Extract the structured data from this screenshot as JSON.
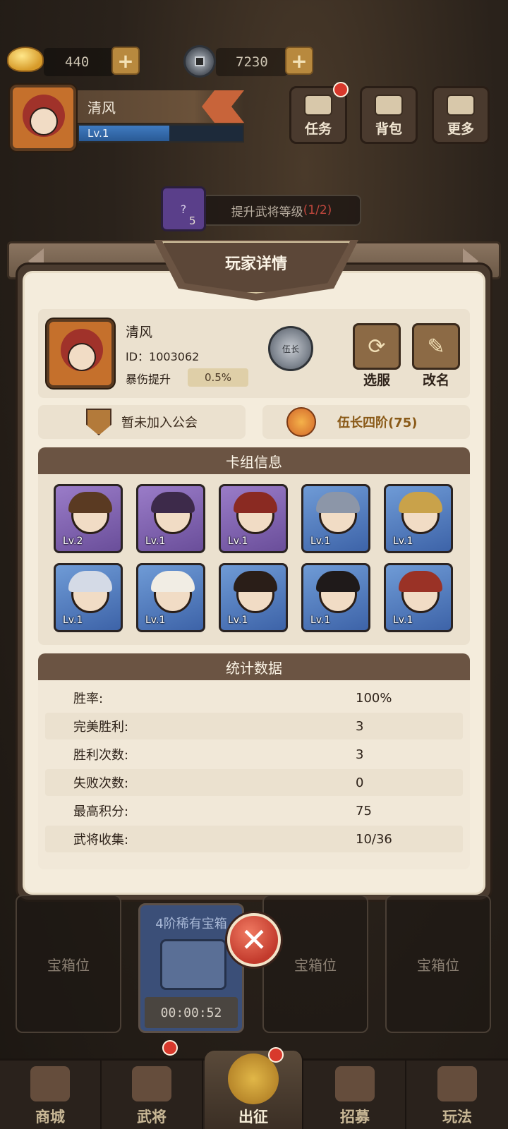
{
  "hud": {
    "gold_value": "440",
    "copper_value": "7230"
  },
  "player_card": {
    "name": "清风",
    "level": "Lv.1",
    "level_fill_pct": 55
  },
  "menu": {
    "task": "任务",
    "bag": "背包",
    "more": "更多"
  },
  "task_hint": {
    "card_count": "5",
    "card_icon_text": "?",
    "text": "提升武将等级",
    "progress": "(1/2)"
  },
  "dialog": {
    "title": "玩家详情",
    "player": {
      "name": "清风",
      "id": "ID：1003062",
      "crit_label": "暴伤提升",
      "crit_value": "0.5%",
      "rank_badge_text": "伍长",
      "switch_server_label": "选服",
      "rename_label": "改名"
    },
    "guild_text": "暂未加入公会",
    "rank_text": "伍长四阶(75)",
    "deck": {
      "title": "卡组信息",
      "heroes": [
        {
          "level": "Lv.2",
          "frame": "purple",
          "hair": "#5a3a22"
        },
        {
          "level": "Lv.1",
          "frame": "purple",
          "hair": "#3d2a4a"
        },
        {
          "level": "Lv.1",
          "frame": "purple",
          "hair": "#8a2a22"
        },
        {
          "level": "Lv.1",
          "frame": "blue",
          "hair": "#8c96a8"
        },
        {
          "level": "Lv.1",
          "frame": "blue",
          "hair": "#c9a24a"
        },
        {
          "level": "Lv.1",
          "frame": "blue",
          "hair": "#d4dae6"
        },
        {
          "level": "Lv.1",
          "frame": "blue",
          "hair": "#f1ede4"
        },
        {
          "level": "Lv.1",
          "frame": "blue",
          "hair": "#2a1e18"
        },
        {
          "level": "Lv.1",
          "frame": "blue",
          "hair": "#1f1a1a"
        },
        {
          "level": "Lv.1",
          "frame": "blue",
          "hair": "#9a3226"
        }
      ]
    },
    "stats": {
      "title": "统计数据",
      "rows": [
        {
          "label": "胜率:",
          "value": "100%"
        },
        {
          "label": "完美胜利:",
          "value": "3"
        },
        {
          "label": "胜利次数:",
          "value": "3"
        },
        {
          "label": "失败次数:",
          "value": "0"
        },
        {
          "label": "最高积分:",
          "value": "75"
        },
        {
          "label": "武将收集:",
          "value": "10/36"
        }
      ]
    }
  },
  "chests": {
    "empty_label": "宝箱位",
    "rare_title": "4阶稀有宝箱",
    "rare_timer": "00:00:52"
  },
  "bottom_nav": {
    "items": [
      "商城",
      "武将",
      "出征",
      "招募",
      "玩法"
    ]
  },
  "colors": {
    "accent_red": "#d8392c",
    "dialog_bg": "#f4ecdc",
    "header_brown": "#6b5443"
  }
}
